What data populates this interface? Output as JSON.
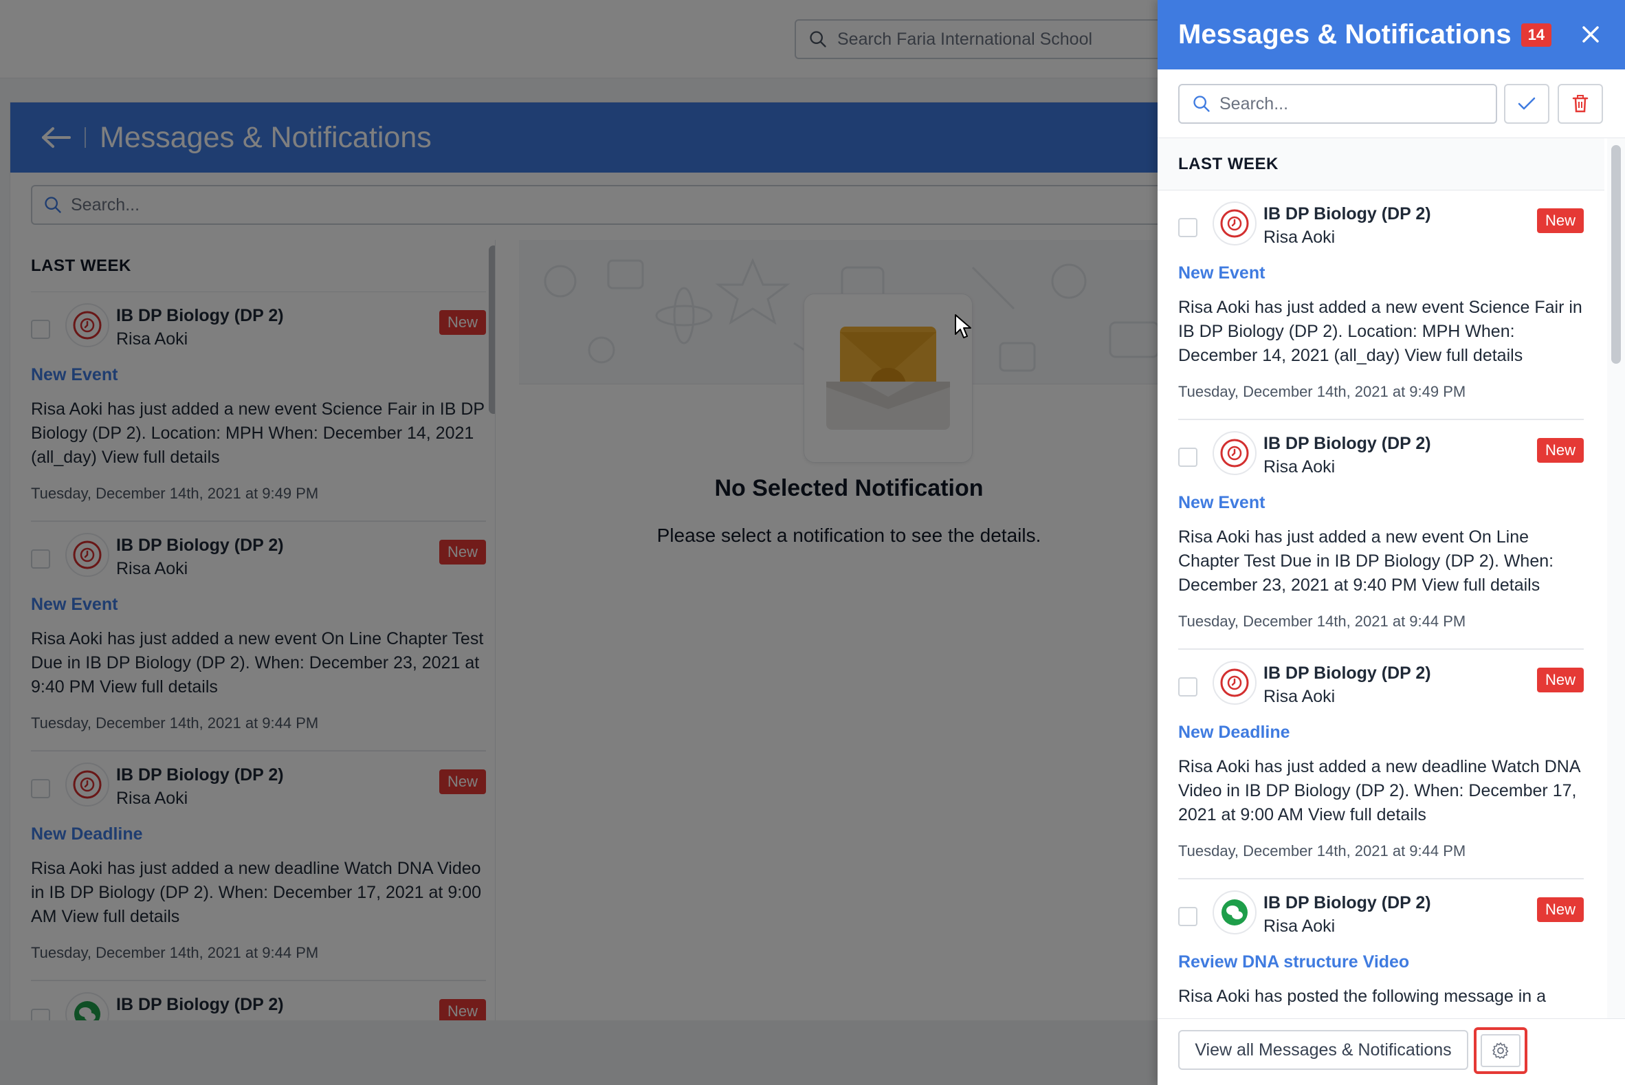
{
  "topbar": {
    "search_placeholder": "Search Faria International School"
  },
  "page": {
    "title": "Messages & Notifications",
    "search_placeholder": "Search...",
    "section_label": "LAST WEEK",
    "empty_title": "No Selected Notification",
    "empty_subtitle": "Please select a notification to see the details."
  },
  "left_notifications": [
    {
      "course": "IB DP Biology (DP 2)",
      "author": "Risa Aoki",
      "badge": "New",
      "type": "New Event",
      "icon": "clock-icon",
      "body": "Risa Aoki has just added a new event Science Fair in IB DP Biology (DP 2). Location: MPH When: December 14, 2021 (all_day) View full details",
      "time": "Tuesday, December 14th, 2021 at 9:49 PM"
    },
    {
      "course": "IB DP Biology (DP 2)",
      "author": "Risa Aoki",
      "badge": "New",
      "type": "New Event",
      "icon": "clock-icon",
      "body": "Risa Aoki has just added a new event On Line Chapter Test Due in IB DP Biology (DP 2). When: December 23, 2021 at 9:40 PM View full details",
      "time": "Tuesday, December 14th, 2021 at 9:44 PM"
    },
    {
      "course": "IB DP Biology (DP 2)",
      "author": "Risa Aoki",
      "badge": "New",
      "type": "New Deadline",
      "icon": "clock-icon",
      "body": "Risa Aoki has just added a new deadline Watch DNA Video in IB DP Biology (DP 2). When: December 17, 2021 at 9:00 AM View full details",
      "time": "Tuesday, December 14th, 2021 at 9:44 PM"
    },
    {
      "course": "IB DP Biology (DP 2)",
      "author": "",
      "badge": "New",
      "type": "",
      "icon": "chat-icon",
      "body": "",
      "time": ""
    }
  ],
  "drawer": {
    "title": "Messages & Notifications",
    "count": "14",
    "search_placeholder": "Search...",
    "section_label": "LAST WEEK",
    "view_all_label": "View all Messages & Notifications",
    "notifications": [
      {
        "course": "IB DP Biology (DP 2)",
        "author": "Risa Aoki",
        "badge": "New",
        "type": "New Event",
        "icon": "clock-icon",
        "body": "Risa Aoki has just added a new event Science Fair in IB DP Biology (DP 2). Location: MPH When: December 14, 2021 (all_day) View full details",
        "time": "Tuesday, December 14th, 2021 at 9:49 PM"
      },
      {
        "course": "IB DP Biology (DP 2)",
        "author": "Risa Aoki",
        "badge": "New",
        "type": "New Event",
        "icon": "clock-icon",
        "body": "Risa Aoki has just added a new event On Line Chapter Test Due in IB DP Biology (DP 2). When: December 23, 2021 at 9:40 PM View full details",
        "time": "Tuesday, December 14th, 2021 at 9:44 PM"
      },
      {
        "course": "IB DP Biology (DP 2)",
        "author": "Risa Aoki",
        "badge": "New",
        "type": "New Deadline",
        "icon": "clock-icon",
        "body": "Risa Aoki has just added a new deadline Watch DNA Video in IB DP Biology (DP 2). When: December 17, 2021 at 9:00 AM View full details",
        "time": "Tuesday, December 14th, 2021 at 9:44 PM"
      },
      {
        "course": "IB DP Biology (DP 2)",
        "author": "Risa Aoki",
        "badge": "New",
        "type": "Review DNA structure Video",
        "icon": "chat-icon",
        "body": "Risa Aoki has posted the following message in a",
        "time": ""
      }
    ]
  },
  "colors": {
    "brand_blue": "#3f7be0",
    "badge_red": "#e53935",
    "clock_red": "#d32f2f",
    "chat_green": "#1e9e4a"
  }
}
